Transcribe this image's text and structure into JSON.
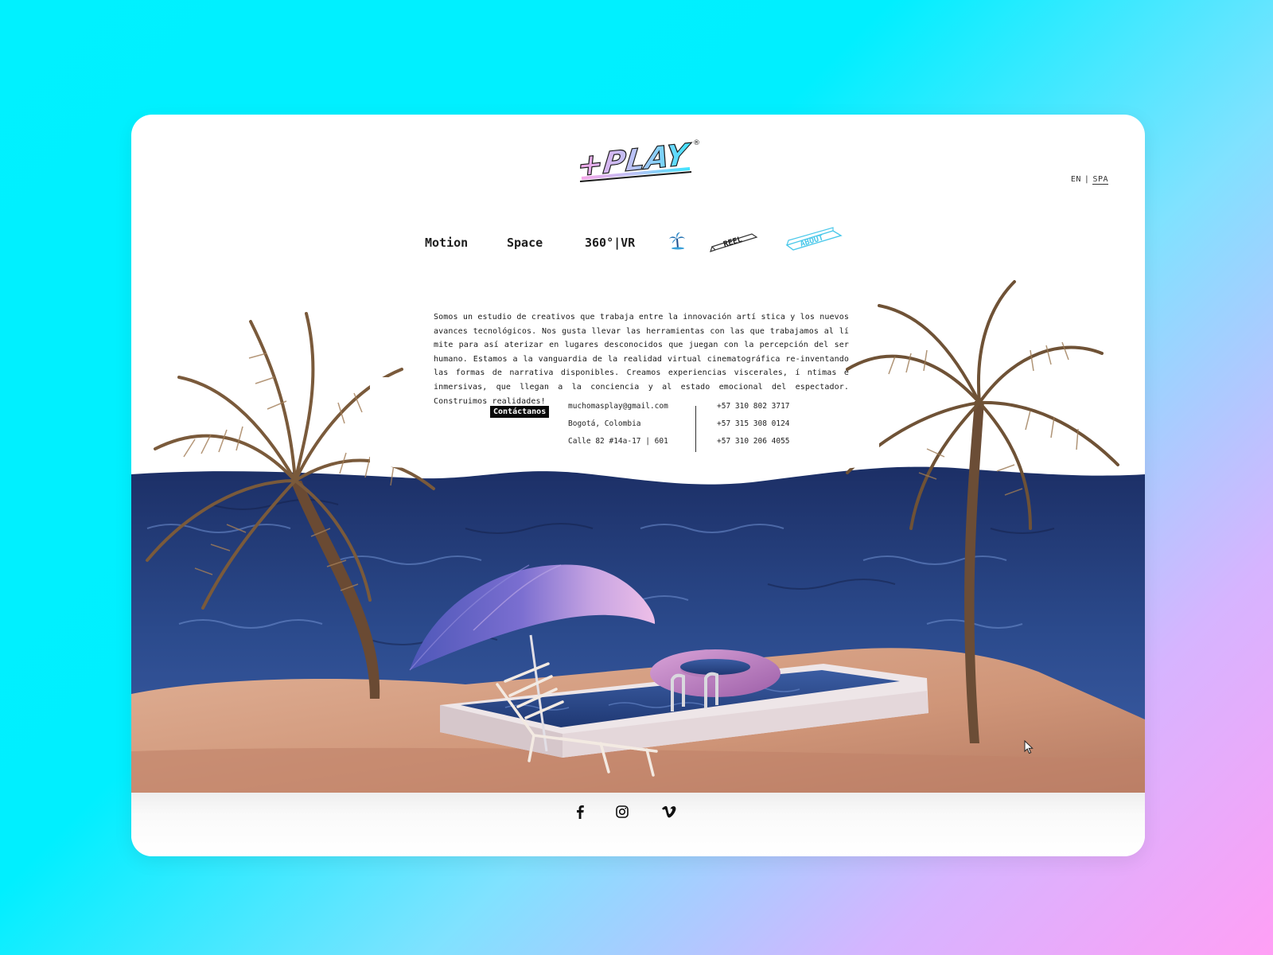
{
  "header": {
    "logo_text": "+PLAY",
    "logo_mark": "®",
    "lang": {
      "en": "EN",
      "separator": "|",
      "es": "SPA"
    }
  },
  "nav": {
    "links": [
      {
        "label": "Motion"
      },
      {
        "label": "Space"
      },
      {
        "label": "360°|VR"
      }
    ],
    "reel_label": "REEL",
    "about_label": "ABOUT",
    "icons": [
      "palm-tree-icon",
      "reel-ticket-icon",
      "about-ticket-icon"
    ]
  },
  "about": {
    "text": "Somos un estudio de creativos que trabaja entre la innovación artí stica y los nuevos avances tecnológicos. Nos gusta llevar las herramientas con las que trabajamos al lí mite para así aterizar en lugares desconocidos que juegan con la percepción del ser humano. Estamos a la vanguardia de la realidad virtual cinematográfica re-inventando las formas de narrativa disponibles. Creamos experiencias viscerales, í ntimas e inmersivas, que llegan a la conciencia y al estado emocional del espectador. Construimos realidades!"
  },
  "contact": {
    "button_label": "Contáctanos",
    "email": "muchomasplay@gmail.com",
    "city": "Bogotá, Colombia",
    "address": "Calle 82 #14a-17 | 601",
    "phones": [
      "+57 310 802 3717",
      "+57 315 308 0124",
      "+57 310 206 4055"
    ]
  },
  "footer": {
    "social": [
      "facebook-icon",
      "instagram-icon",
      "vimeo-icon"
    ]
  },
  "colors": {
    "background_start": "#00f1ff",
    "background_end": "#ff9ff5",
    "ocean": "#25407a",
    "sand": "#d9a07f",
    "umbrella": "#8f78cf",
    "float": "#c58ac4"
  }
}
